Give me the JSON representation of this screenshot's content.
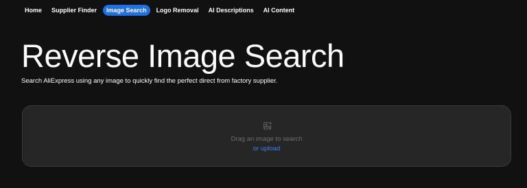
{
  "nav": {
    "items": [
      {
        "label": "Home",
        "active": false
      },
      {
        "label": "Supplier Finder",
        "active": false
      },
      {
        "label": "Image Search",
        "active": true
      },
      {
        "label": "Logo Removal",
        "active": false
      },
      {
        "label": "AI Descriptions",
        "active": false
      },
      {
        "label": "AI Content",
        "active": false
      }
    ]
  },
  "hero": {
    "title": "Reverse Image Search",
    "subtitle": "Search AliExpress using any image to quickly find the perfect direct from factory supplier."
  },
  "dropzone": {
    "icon": "image-add-icon",
    "prompt": "Drag an image to search",
    "upload_label": "or upload"
  },
  "colors": {
    "background": "#111112",
    "accent": "#1f6fe5",
    "link": "#3b82f6",
    "dropzone_bg": "#262627",
    "muted_text": "#6e6e72"
  }
}
